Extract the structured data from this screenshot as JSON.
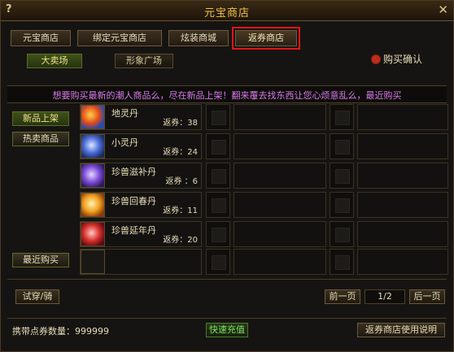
{
  "window": {
    "title": "元宝商店",
    "help": "?",
    "close": "✕"
  },
  "tabs": [
    "元宝商店",
    "绑定元宝商店",
    "炫装商城",
    "返券商店"
  ],
  "subtabs": [
    "大卖场",
    "形象广场"
  ],
  "confirm": {
    "label": "购买确认",
    "color": "#c42a1a"
  },
  "banner": "想要购买最新的潮人商品么，尽在新品上架！翻来覆去找东西让您心烦意乱么，最近购买",
  "side_nav": [
    "新品上架",
    "热卖商品",
    "最近购买"
  ],
  "items": [
    {
      "name": "地灵丹",
      "price": "返券：38",
      "icon": "orange-blue-orb-icon"
    },
    {
      "name": "小灵丹",
      "price": "返券：24",
      "icon": "blue-orb-icon"
    },
    {
      "name": "珍兽滋补丹",
      "price": "返券 ：6",
      "icon": "purple-orb-icon"
    },
    {
      "name": "珍兽回春丹",
      "price": "返券：11",
      "icon": "gold-orb-icon"
    },
    {
      "name": "珍兽延年丹",
      "price": "返券：20",
      "icon": "red-orb-icon"
    }
  ],
  "bottom": {
    "try_on": "试穿/骑",
    "prev": "前一页",
    "page": "1/2",
    "next": "后一页",
    "balance": "携带点券数量：999999",
    "recharge": "快速充值",
    "help": "返券商店使用说明"
  },
  "colors": {
    "accent": "#f2c24a",
    "highlight": "#e41515",
    "banner_text": "#d77ae8",
    "green": "#7be06a"
  }
}
